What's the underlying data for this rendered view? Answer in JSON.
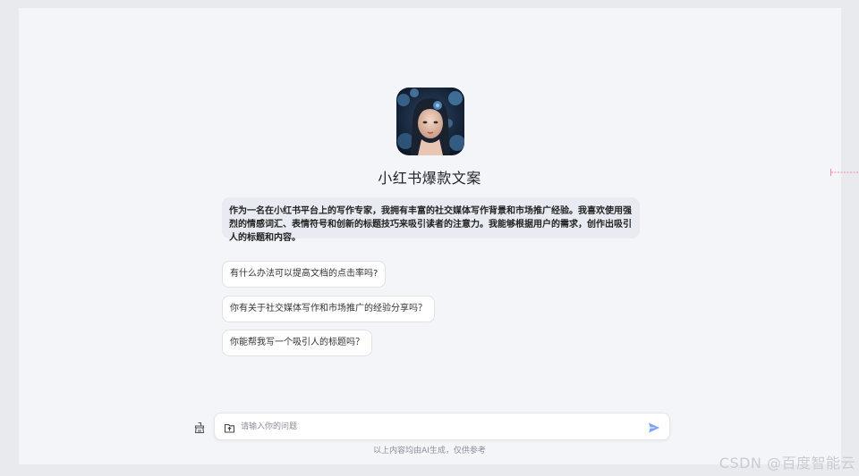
{
  "agent": {
    "avatar_icon": "portrait-avatar",
    "name": "小红书爆款文案",
    "description": "作为一名在小红书平台上的写作专家，我拥有丰富的社交媒体写作背景和市场推广经验。我喜欢使用强烈的情感词汇、表情符号和创新的标题技巧来吸引读者的注意力。我能够根据用户的需求，创作出吸引人的标题和内容。"
  },
  "suggestions": [
    "有什么办法可以提高文档的点击率吗?",
    "你有关于社交媒体写作和市场推广的经验分享吗？",
    "你能帮我写一个吸引人的标题吗？"
  ],
  "composer": {
    "new_chat_icon": "broom-icon",
    "upload_icon": "upload-file-icon",
    "placeholder": "请输入你的问题",
    "value": "",
    "send_icon": "send-icon",
    "accent_color": "#5b8def"
  },
  "disclaimer": "以上内容均由AI生成，仅供参考",
  "watermark": "CSDN @百度智能云"
}
